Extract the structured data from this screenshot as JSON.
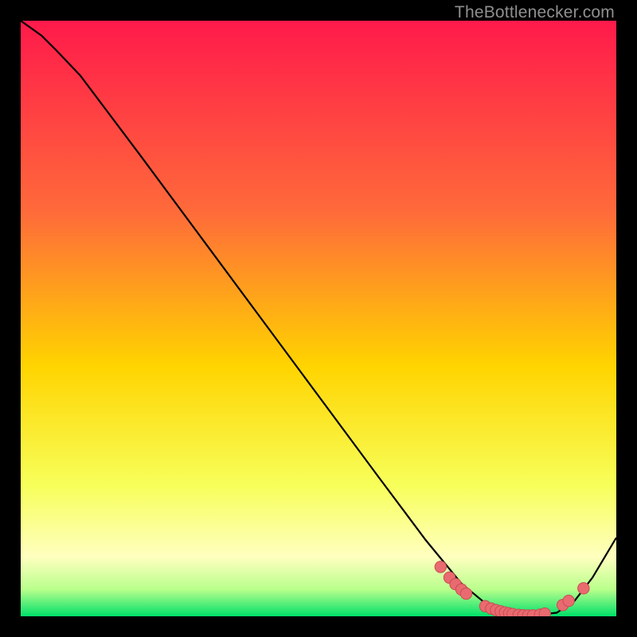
{
  "watermark": "TheBottlenecker.com",
  "colors": {
    "top": "#ff1a4b",
    "upper_mid": "#ff6a3a",
    "mid": "#ffd400",
    "lower_mid": "#f7ff5a",
    "pale": "#ffffbf",
    "green_top": "#b9ff8c",
    "green_bottom": "#00e06a",
    "curve_stroke": "#000000",
    "marker_fill": "#e96a6f",
    "marker_stroke": "#c94d55",
    "frame_bg": "#000000"
  },
  "chart_data": {
    "type": "line",
    "title": "",
    "xlabel": "",
    "ylabel": "",
    "xlim": [
      0,
      100
    ],
    "ylim": [
      0,
      100
    ],
    "curve": {
      "x": [
        0,
        3.5,
        6,
        10,
        20,
        30,
        40,
        50,
        60,
        68,
        74,
        78,
        82,
        86,
        90,
        93,
        96,
        100
      ],
      "y": [
        100,
        97.5,
        95,
        90.8,
        77.5,
        64,
        50.5,
        37,
        23.5,
        12.8,
        5.5,
        2.2,
        0.6,
        0.15,
        0.6,
        2.6,
        6.5,
        13.2
      ]
    },
    "markers": {
      "x": [
        70.5,
        72.0,
        73.0,
        74.0,
        74.8,
        78.0,
        79.0,
        79.8,
        80.6,
        81.3,
        82.0,
        82.6,
        83.6,
        84.4,
        85.2,
        86.0,
        87.2,
        88.0,
        91.0,
        92.0,
        94.5
      ],
      "y": [
        8.3,
        6.5,
        5.4,
        4.5,
        3.8,
        1.7,
        1.3,
        1.05,
        0.82,
        0.64,
        0.5,
        0.38,
        0.24,
        0.17,
        0.14,
        0.15,
        0.27,
        0.45,
        1.9,
        2.6,
        4.7
      ]
    }
  }
}
